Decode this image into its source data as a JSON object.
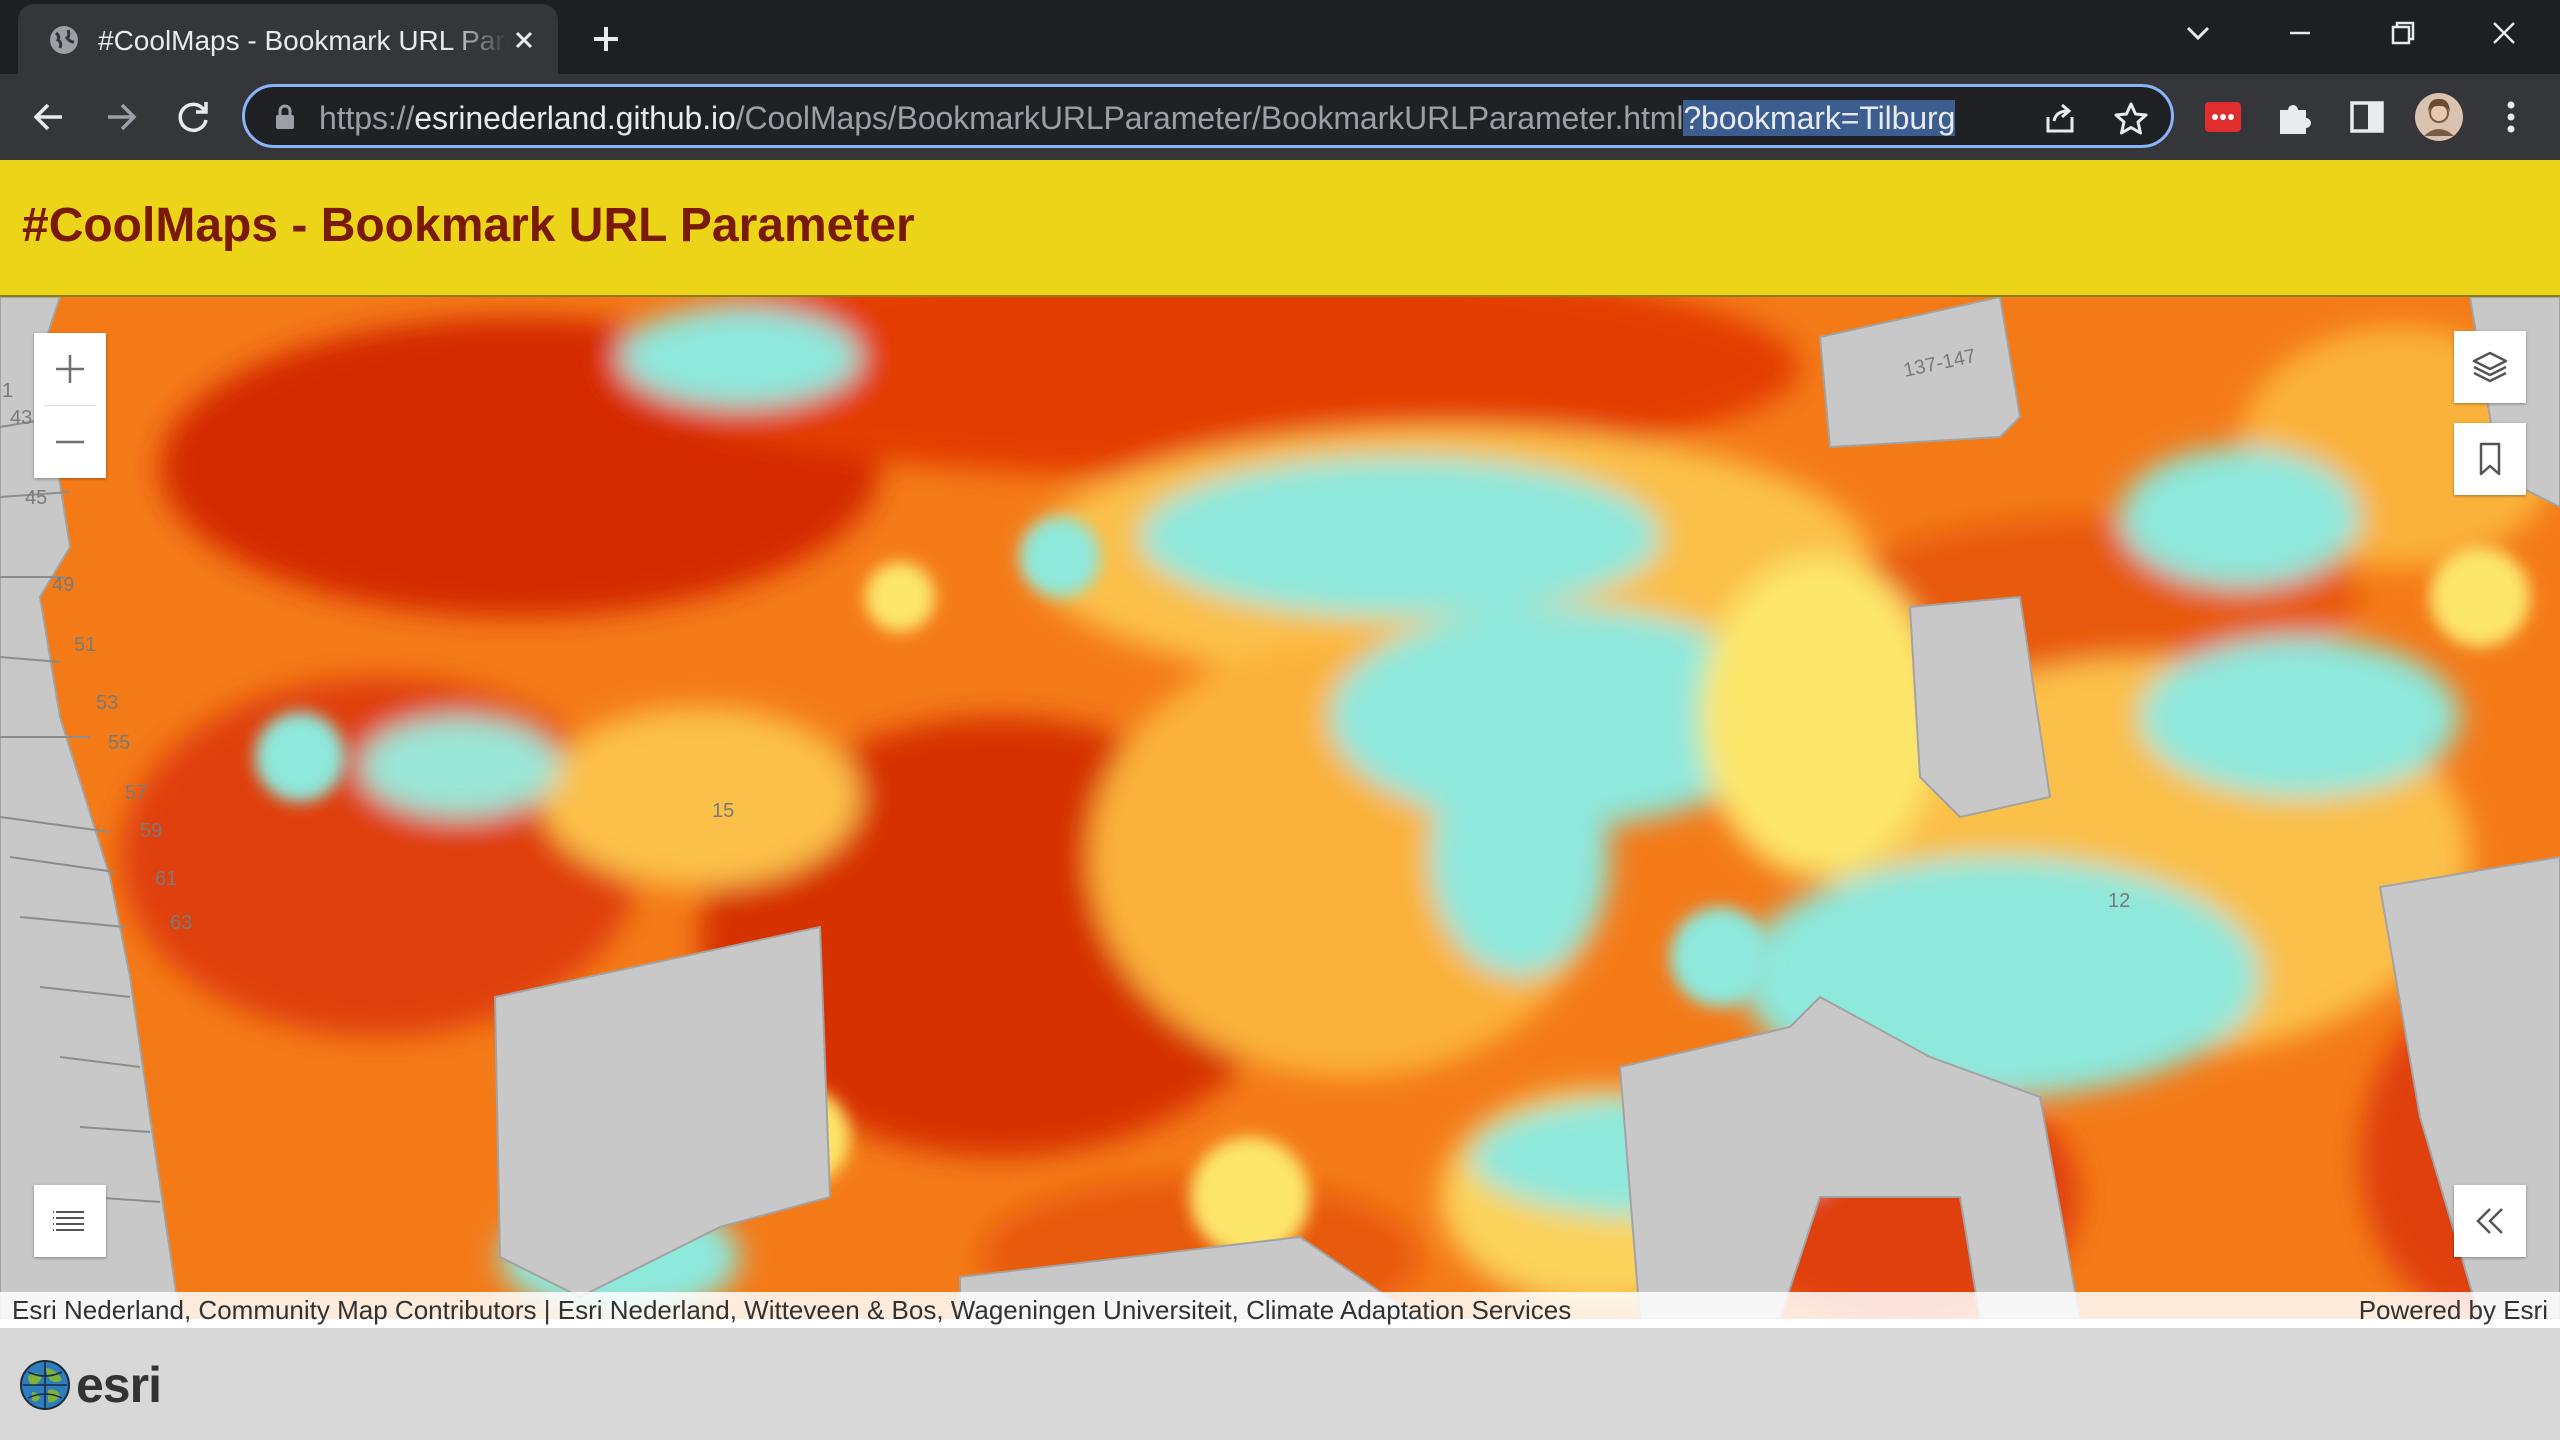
{
  "browser": {
    "tab_title": "#CoolMaps - Bookmark URL Parameter",
    "url_scheme": "https://",
    "url_host": "esrinederland.github.io",
    "url_path": "/CoolMaps/BookmarkURLParameter/BookmarkURLParameter.html",
    "url_query": "?bookmark=Tilburg"
  },
  "page": {
    "title": "#CoolMaps - Bookmark URL Parameter"
  },
  "map": {
    "labels": [
      "137-147",
      "43",
      "45",
      "49",
      "51",
      "53",
      "55",
      "57",
      "59",
      "61",
      "63",
      "15",
      "12",
      "1"
    ],
    "attribution_left": "Esri Nederland, Community Map Contributors | Esri Nederland, Witteveen & Bos, Wageningen Universiteit, Climate Adaptation Services",
    "attribution_right": "Powered by Esri",
    "colors": {
      "hot": "#d42a00",
      "warm": "#f26b10",
      "mild": "#fbb23a",
      "cool": "#fce66a",
      "cold": "#8ee8dc",
      "building": "#c8c8c8"
    }
  },
  "footer": {
    "logo_text": "esri"
  },
  "icons": [
    "globe-icon",
    "close-icon",
    "plus-icon",
    "chevron-down-icon",
    "minimize-icon",
    "restore-icon",
    "back-icon",
    "forward-icon",
    "reload-icon",
    "lock-icon",
    "share-icon",
    "star-icon",
    "extension-icon",
    "puzzle-icon",
    "sidepanel-icon",
    "profile-avatar",
    "kebab-menu-icon",
    "zoom-in-icon",
    "zoom-out-icon",
    "layers-icon",
    "bookmark-icon",
    "list-icon",
    "double-chevron-left-icon",
    "esri-globe-icon"
  ]
}
